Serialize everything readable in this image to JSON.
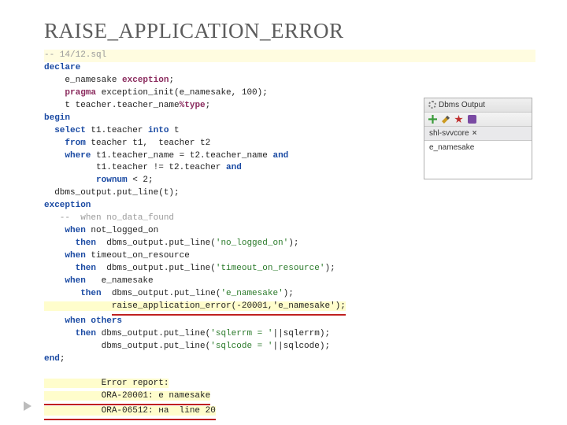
{
  "title": "RAISE_APPLICATION_ERROR",
  "code": {
    "file_comment": "-- 14/12.sql",
    "l1": "declare",
    "l2a": "    e_namesake ",
    "l2b": "exception",
    "l2c": ";",
    "l3a": "    pragma",
    "l3b": " exception_init(e_namesake, 100);",
    "l4a": "    t teacher.teacher_name",
    "l4b": "%type",
    "l4c": ";",
    "l5": "begin",
    "l6a": "  select",
    "l6b": " t1.teacher ",
    "l6c": "into",
    "l6d": " t",
    "l7a": "    from",
    "l7b": " teacher t1,  teacher t2",
    "l8a": "    where",
    "l8b": " t1.teacher_name = t2.teacher_name ",
    "l8c": "and",
    "l9a": "          t1.teacher != t2.teacher ",
    "l9b": "and",
    "l10a": "          rownum",
    "l10b": " < 2;",
    "l11": "  dbms_output.put_line(t);",
    "l12": "exception",
    "l13a": "   --",
    "l13b": "  when no_data_found",
    "l14a": "    when",
    "l14b": " not_logged_on",
    "l15a": "      then",
    "l15b": "  dbms_output.put_line(",
    "l15c": "'no_logged_on'",
    "l15d": ");",
    "l16a": "    when",
    "l16b": " timeout_on_resource",
    "l17a": "      then",
    "l17b": "  dbms_output.put_line(",
    "l17c": "'timeout_on_resource'",
    "l17d": ");",
    "l18a": "    when",
    "l18b": "   e_namesake",
    "l19a": "       then",
    "l19b": "  dbms_output.put_line(",
    "l19c": "'e_namesake'",
    "l19d": ");",
    "l20a": "             ",
    "l20b": "raise_application_error(-20001,'e_namesake');",
    "l21a": "    when others",
    "l22a": "      then",
    "l22b": " dbms_output.put_line(",
    "l22c": "'sqlerrm = '",
    "l22d": "||sqlerrm);",
    "l23a": "           dbms_output.put_line(",
    "l23b": "'sqlcode = '",
    "l23c": "||sqlcode);",
    "l24": "end",
    "l24b": ";",
    "blank": "",
    "err1": "           Error report:",
    "err2": "           ORA-20001: e namesake",
    "err3": "           ORA-06512: на  line 20"
  },
  "panel": {
    "title": "Dbms Output",
    "tab": "shl-svvcore",
    "close": "×",
    "content": "e_namesake"
  }
}
